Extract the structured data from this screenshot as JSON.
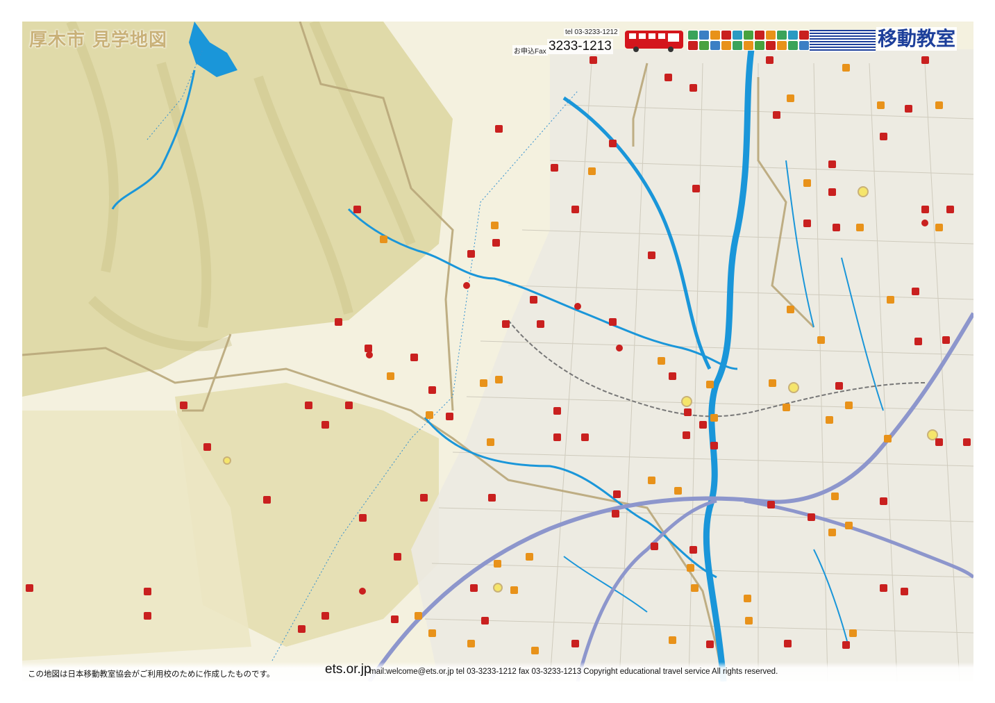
{
  "map": {
    "title": "厚木市 見学地図",
    "header": {
      "tel": "tel 03-3233-1212",
      "fax_label": "お申込Fax",
      "fax_number": "3233-1213",
      "brand": "移動教室",
      "brand_color": "#1d3f9a",
      "bus_color": "#d4161c"
    },
    "footer": {
      "notice": "この地図は日本移動教室協会がご利用校のために作成したものです。",
      "site": "ets.or.jp",
      "contact": "mail:welcome@ets.or.jp  tel 03-3233-1212  fax 03-3233-1213  Copyright educational travel service All rights reserved."
    },
    "colors": {
      "land": "#f4f1df",
      "hills": "#d9d49a",
      "water": "#1a96d9",
      "highway": "#8d96cc",
      "boundary": "#b8a679",
      "poi_red": "#c9201f",
      "poi_orange": "#e8921a"
    },
    "icons": [
      "bus-icon",
      "temple-icon",
      "shrine-icon",
      "fire-station-icon",
      "post-office-icon",
      "hospital-icon",
      "school-icon",
      "park-icon",
      "mountain-icon",
      "library-icon"
    ]
  }
}
